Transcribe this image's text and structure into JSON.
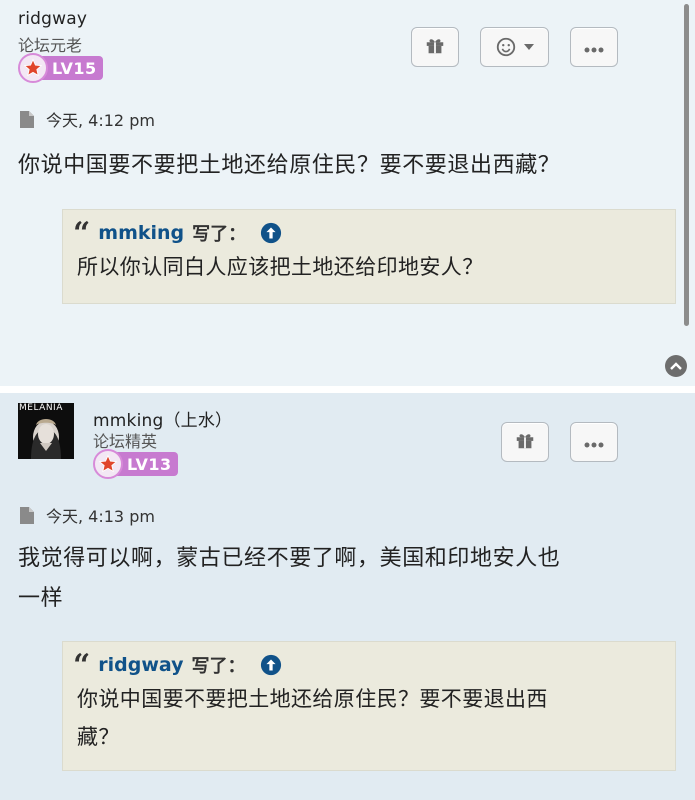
{
  "posts": [
    {
      "username": "ridgway",
      "rank": "论坛元老",
      "level": "LV15",
      "time": "今天, 4:12 pm",
      "content": "你说中国要不要把土地还给原住民？要不要退出西藏？",
      "quote": {
        "author": "mmking",
        "wrote": "写了：",
        "text": "所以你认同白人应该把土地还给印地安人？"
      }
    },
    {
      "username": "mmking（上水）",
      "rank": "论坛精英",
      "level": "LV13",
      "avatar_label": "MELANIA",
      "time": "今天, 4:13 pm",
      "content_line1": "我觉得可以啊，蒙古已经不要了啊，美国和印地安人也",
      "content_line2": "一样",
      "quote": {
        "author": "ridgway",
        "wrote": "写了：",
        "text_line1": "你说中国要不要把土地还给原住民？要不要退出西",
        "text_line2": "藏？"
      }
    }
  ],
  "icons": {
    "gift": "gift-icon",
    "reaction": "smiley-icon",
    "more": "ellipsis-icon",
    "doc": "document-icon",
    "up": "up-arrow-circle-icon",
    "back_to_top": "chevron-up-icon"
  },
  "colors": {
    "post1_bg": "#ecf3f7",
    "post2_bg": "#e1ebf2",
    "quote_bg": "#ebeadd",
    "quote_author": "#105289",
    "level_badge": "#c77ad0"
  }
}
